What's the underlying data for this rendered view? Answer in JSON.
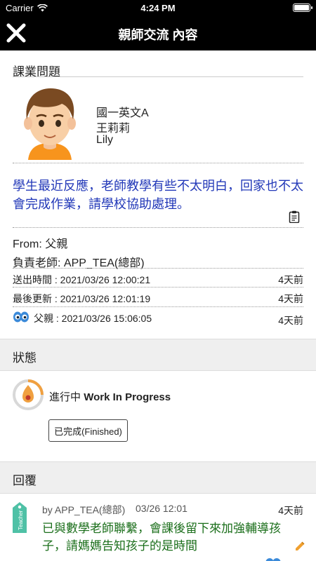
{
  "status_bar": {
    "carrier": "Carrier",
    "time": "4:24 PM",
    "battery_level": 1.0
  },
  "nav": {
    "title": "親師交流 內容",
    "close_icon": "close-icon"
  },
  "issue": {
    "section_title": "課業問題",
    "class_name": "國一英文A",
    "student_name": "王莉莉",
    "student_english_name": "Lily",
    "message": "學生最近反應，老師教學有些不太明白，回家也不太會完成作業，請學校協助處理。",
    "from": "From: 父親",
    "teacher": "負責老師: APP_TEA(總部)",
    "sent_time": "送出時間 : 2021/03/26 12:00:21",
    "sent_ago": "4天前",
    "updated_time": "最後更新 : 2021/03/26 12:01:19",
    "updated_ago": "4天前",
    "read_by": "父親 : 2021/03/26 15:06:05",
    "read_ago": "4天前"
  },
  "status": {
    "section_title": "狀態",
    "state_label": "進行中",
    "state_label_en": "Work In Progress",
    "finished_button": "已完成(Finished)"
  },
  "reply": {
    "section_title": "回覆",
    "author": "by APP_TEA(總部)",
    "date": "03/26 12:01",
    "ago": "4天前",
    "text": "已與數學老師聯繫，會課後留下來加強輔導孩子，請媽媽告知孩子的是時間",
    "tag_label": "Teacher"
  },
  "colors": {
    "nav_bg": "#000000",
    "message": "#2238b8",
    "reply_text": "#1a6e1a",
    "section_band": "#efefef",
    "progress_accent": "#f0a040"
  }
}
